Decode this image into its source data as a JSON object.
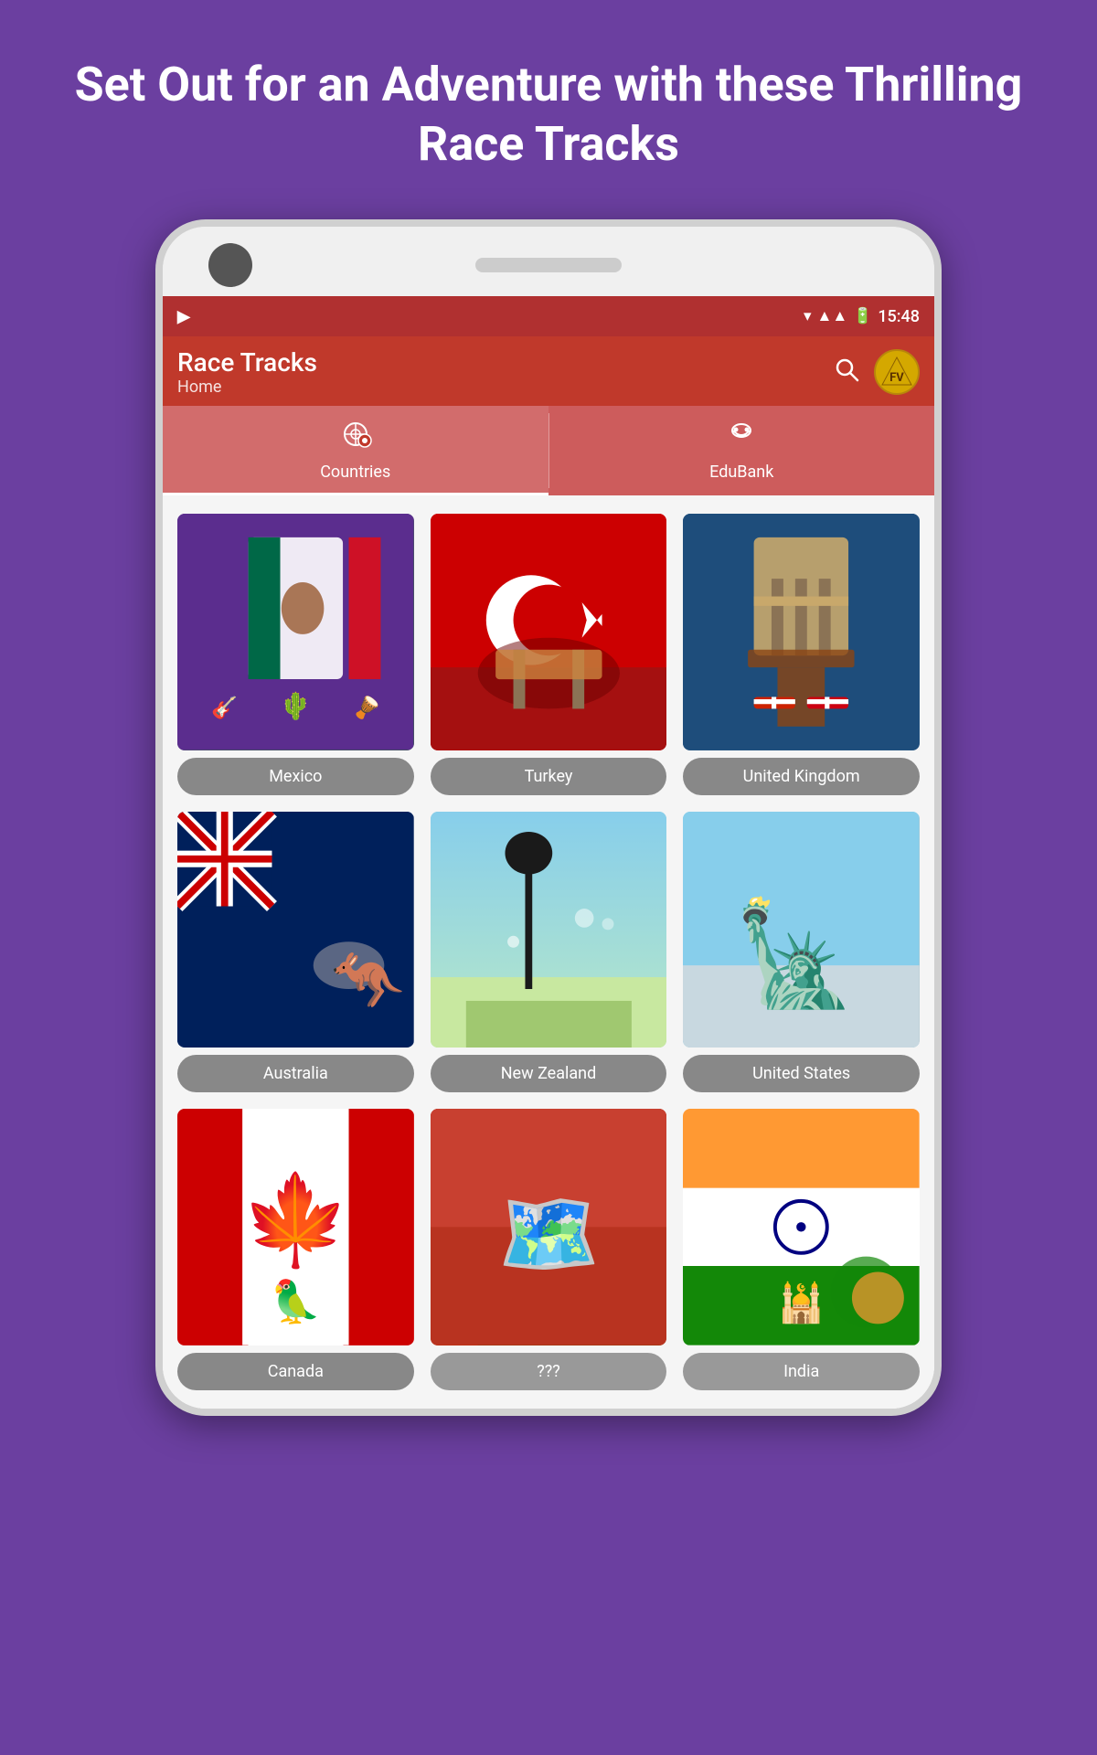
{
  "header": {
    "title": "Set Out for an Adventure with these Thrilling Race Tracks"
  },
  "status_bar": {
    "time": "15:48",
    "notification_icon": "N"
  },
  "app_bar": {
    "title": "Race Tracks",
    "subtitle": "Home",
    "logo": "FV"
  },
  "tabs": [
    {
      "id": "countries",
      "label": "Countries",
      "active": true
    },
    {
      "id": "edubank",
      "label": "EduBank",
      "active": false
    }
  ],
  "countries": [
    {
      "id": "mexico",
      "label": "Mexico",
      "emoji": "🇲🇽"
    },
    {
      "id": "turkey",
      "label": "Turkey",
      "emoji": "🇹🇷"
    },
    {
      "id": "uk",
      "label": "United Kingdom",
      "emoji": "🇬🇧"
    },
    {
      "id": "australia",
      "label": "Australia",
      "emoji": "🇦🇺"
    },
    {
      "id": "new-zealand",
      "label": "New Zealand",
      "emoji": "🇳🇿"
    },
    {
      "id": "united-states",
      "label": "United States",
      "emoji": "🇺🇸"
    },
    {
      "id": "canada",
      "label": "Canada",
      "emoji": "🇨🇦"
    },
    {
      "id": "mystery",
      "label": "???",
      "emoji": "🗺️"
    },
    {
      "id": "india",
      "label": "India",
      "emoji": "🇮🇳"
    }
  ]
}
